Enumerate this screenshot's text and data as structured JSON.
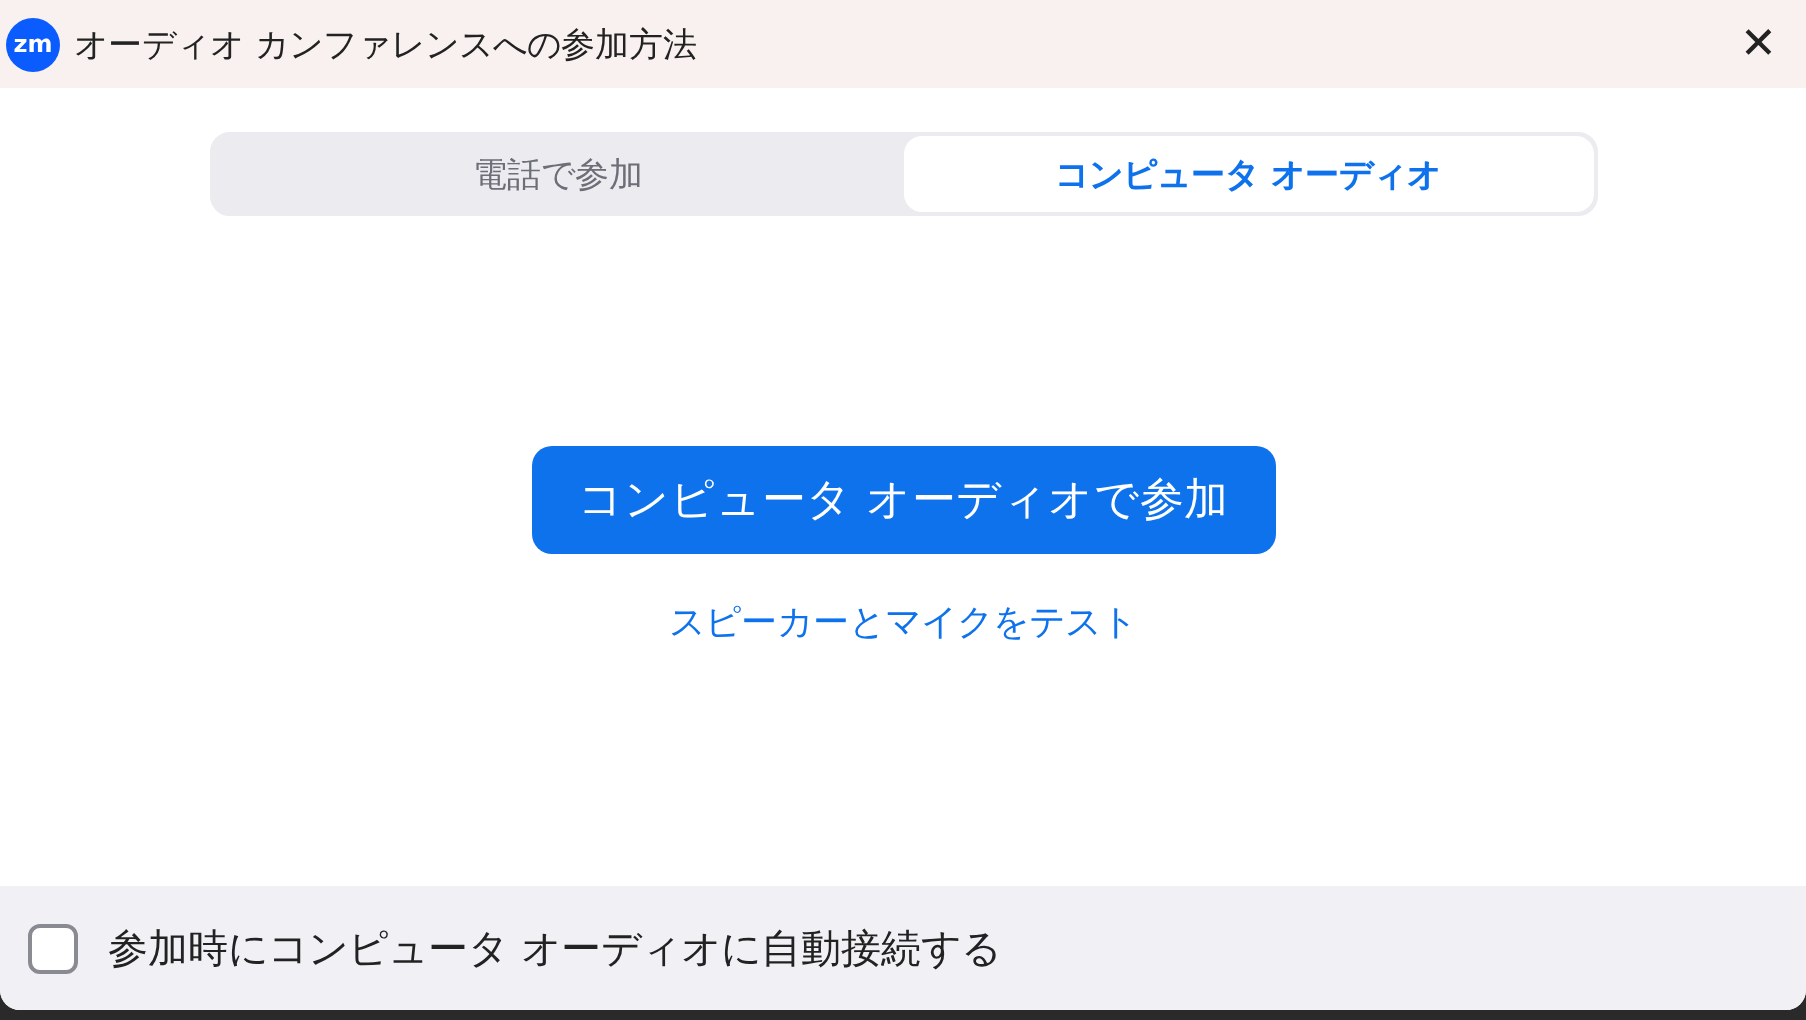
{
  "window": {
    "logo": "zm",
    "title": "オーディオ カンファレンスへの参加方法",
    "close": "✕"
  },
  "tabs": [
    {
      "label": "電話で参加",
      "selected": false
    },
    {
      "label": "コンピュータ オーディオ",
      "selected": true
    }
  ],
  "join_button": "コンピュータ オーディオで参加",
  "test_link": "スピーカーとマイクをテスト",
  "auto_connect": {
    "label": "参加時にコンピュータ オーディオに自動接続する",
    "checked": false
  }
}
